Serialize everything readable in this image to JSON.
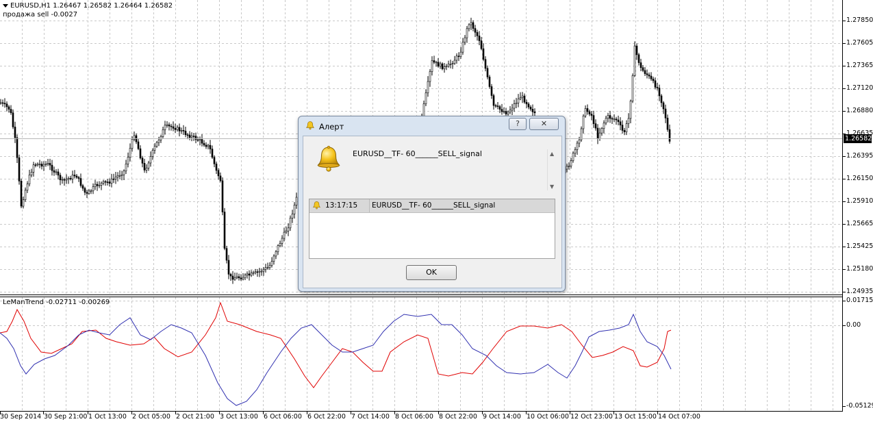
{
  "chart": {
    "symbol_label": "EURUSD,H1  1.26467 1.26582 1.26464 1.26582",
    "comment": "продажа sell -0.0027",
    "current_price": "1.26582",
    "price_labels": [
      "1.27850",
      "1.27605",
      "1.27365",
      "1.27120",
      "1.26880",
      "1.26635",
      "1.26395",
      "1.26150",
      "1.25910",
      "1.25665",
      "1.25425",
      "1.25180",
      "1.24935"
    ],
    "up_color": "#000000",
    "down_color": "#000000"
  },
  "indicator": {
    "label": "LeManTrend -0.02711 -0.00269",
    "scale_labels": [
      "0.01715",
      "0.00",
      "-0.05129"
    ],
    "series_colors": {
      "red": "#e00000",
      "blue": "#3030b0"
    }
  },
  "time_axis": {
    "labels": [
      "30 Sep 2014",
      "30 Sep 21:00",
      "1 Oct 13:00",
      "2 Oct 05:00",
      "2 Oct 21:00",
      "3 Oct 13:00",
      "6 Oct 06:00",
      "6 Oct 22:00",
      "7 Oct 14:00",
      "8 Oct 06:00",
      "8 Oct 22:00",
      "9 Oct 14:00",
      "10 Oct 06:00",
      "12 Oct 23:00",
      "13 Oct 15:00",
      "14 Oct 07:00"
    ]
  },
  "dialog": {
    "title": "Алерт",
    "help_label": "?",
    "close_label": "✕",
    "message": "EURUSD__TF- 60______SELL_signal",
    "log_entries": [
      {
        "time": "13:17:15",
        "message": "EURUSD__TF- 60______SELL_signal"
      }
    ],
    "ok_label": "OK",
    "icon": "bell-icon"
  }
}
